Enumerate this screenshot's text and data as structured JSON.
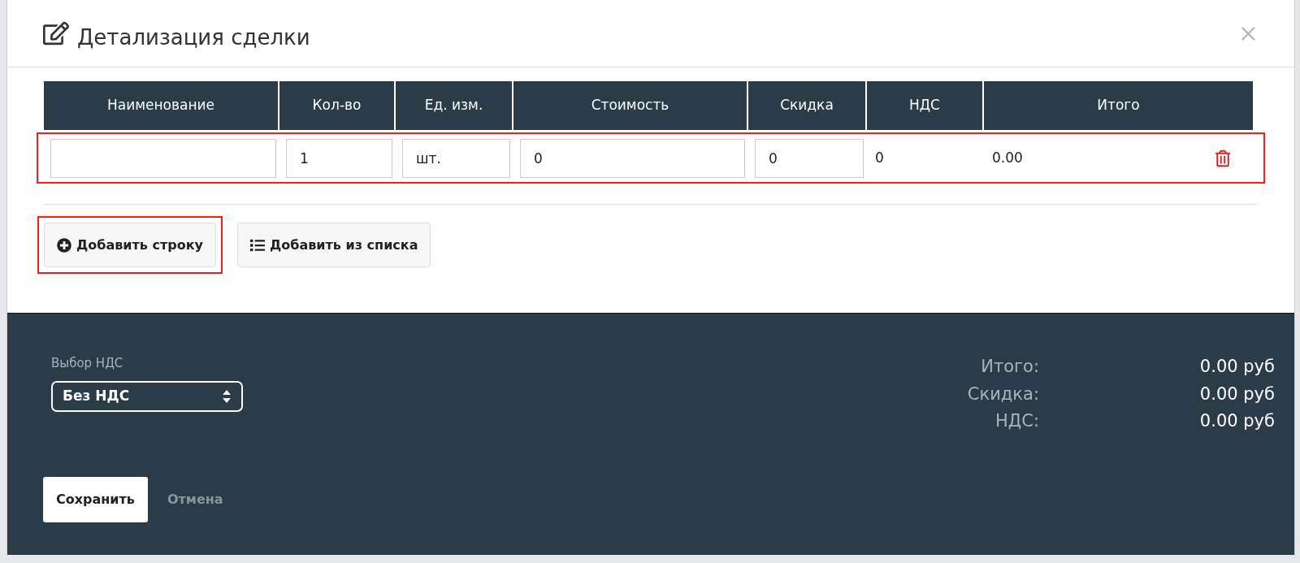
{
  "modal": {
    "title": "Детализация сделки",
    "close": "×"
  },
  "table": {
    "columns": [
      "Наименование",
      "Кол-во",
      "Ед. изм.",
      "Стоимость",
      "Скидка",
      "НДС",
      "Итого"
    ],
    "rows": [
      {
        "highlighted": true,
        "cells": [
          {
            "kind": "input"
          },
          {
            "kind": "input",
            "value": "1"
          },
          {
            "kind": "input",
            "value": "шт."
          },
          {
            "kind": "input",
            "value": "0"
          },
          {
            "kind": "input",
            "value": "0"
          },
          {
            "kind": "text",
            "value": "0"
          },
          {
            "kind": "text",
            "value": "0.00"
          }
        ]
      }
    ]
  },
  "actions": [
    {
      "label": "Добавить строку",
      "kind": "plus",
      "highlighted": true
    },
    {
      "label": "Добавить из списка",
      "kind": "list",
      "highlighted": false
    }
  ],
  "footer": {
    "vat_label": "Выбор НДС",
    "vat_select": "Без НДС",
    "totals": [
      {
        "label": "Итого:",
        "value": "0.00 руб"
      },
      {
        "label": "Скидка:",
        "value": "0.00 руб"
      },
      {
        "label": "НДС:",
        "value": "0.00 руб"
      }
    ],
    "save": "Сохранить",
    "cancel": "Отмена"
  }
}
